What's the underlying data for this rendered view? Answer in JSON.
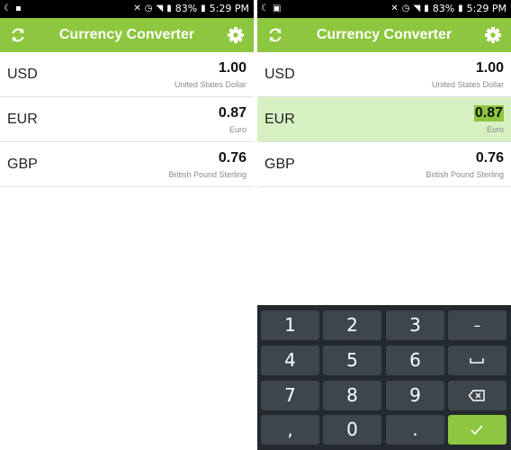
{
  "phones": [
    {
      "status": {
        "battery": "83%",
        "time": "5:29 PM",
        "left_icons": [
          "moon-icon",
          "app-icon"
        ]
      },
      "appbar": {
        "title": "Currency Converter",
        "left_icon": "refresh-icon",
        "right_icon": "settings-gear-icon"
      },
      "rows": [
        {
          "code": "USD",
          "value": "1.00",
          "name": "United States Dollar",
          "selected": false
        },
        {
          "code": "EUR",
          "value": "0.87",
          "name": "Euro",
          "selected": false
        },
        {
          "code": "GBP",
          "value": "0.76",
          "name": "British Pound Sterling",
          "selected": false
        }
      ]
    },
    {
      "status": {
        "battery": "83%",
        "time": "5:29 PM",
        "left_icons": [
          "moon-icon",
          "image-icon"
        ]
      },
      "appbar": {
        "title": "Currency Converter",
        "left_icon": "refresh-icon",
        "right_icon": "settings-gear-icon"
      },
      "rows": [
        {
          "code": "USD",
          "value": "1.00",
          "name": "United States Dollar",
          "selected": false
        },
        {
          "code": "EUR",
          "value": "0.87",
          "name": "Euro",
          "selected": true
        },
        {
          "code": "GBP",
          "value": "0.76",
          "name": "British Pound Sterling",
          "selected": false
        }
      ],
      "keyboard": {
        "keys": [
          [
            "1",
            "2",
            "3",
            "–"
          ],
          [
            "4",
            "5",
            "6",
            "space-icon"
          ],
          [
            "7",
            "8",
            "9",
            "backspace-icon"
          ],
          [
            ",",
            "0",
            ".",
            "checkmark-icon"
          ]
        ]
      }
    }
  ],
  "colors": {
    "accent": "#8dc63f",
    "selected_row": "#d7f0c2",
    "keyboard_bg": "#23292e",
    "key_bg": "#3d454d"
  }
}
